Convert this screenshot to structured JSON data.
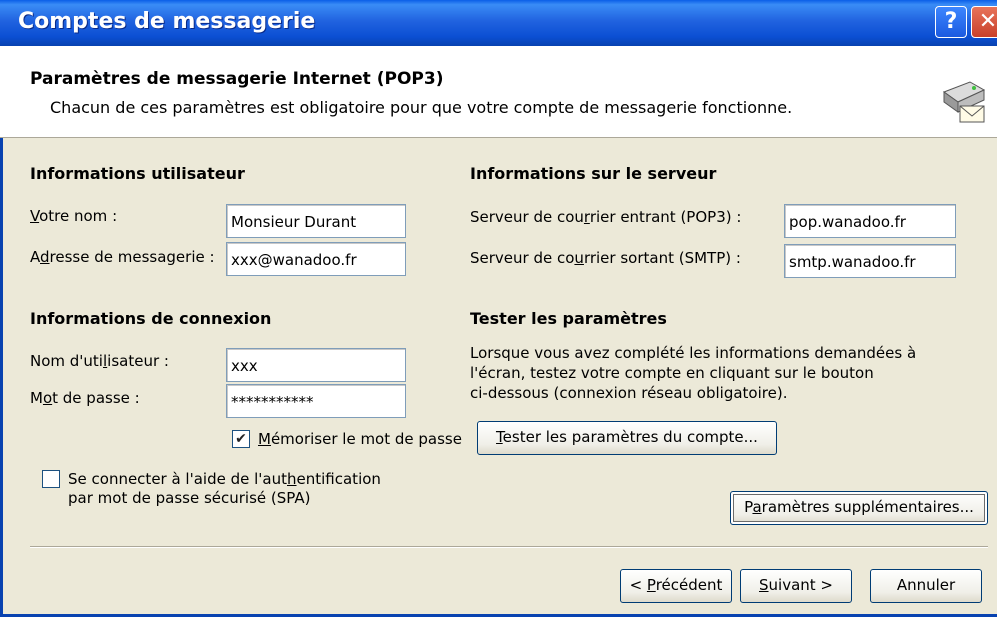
{
  "window": {
    "title": "Comptes de messagerie",
    "help_glyph": "?",
    "close_glyph": "✕"
  },
  "header": {
    "title": "Paramètres de messagerie Internet (POP3)",
    "subtitle": "Chacun de ces paramètres est obligatoire pour que votre compte de messagerie fonctionne.",
    "icon": "mail-server-icon"
  },
  "user_info": {
    "heading": "Informations utilisateur",
    "name_label": "Votre nom :",
    "name_value": "Monsieur Durant",
    "email_label": "Adresse de messagerie :",
    "email_value": "xxx@wanadoo.fr"
  },
  "server_info": {
    "heading": "Informations sur le serveur",
    "incoming_label": "Serveur de courrier entrant (POP3) :",
    "incoming_value": "pop.wanadoo.fr",
    "outgoing_label": "Serveur de courrier sortant (SMTP) :",
    "outgoing_value": "smtp.wanadoo.fr"
  },
  "login_info": {
    "heading": "Informations de connexion",
    "username_label": "Nom d'utilisateur :",
    "username_value": "xxx",
    "password_label": "Mot de passe :",
    "password_value": "***********",
    "remember_label": "Mémoriser le mot de passe",
    "remember_checked": true,
    "spa_label_line1": "Se connecter à l'aide de l'authentification",
    "spa_label_line2": "par mot de passe sécurisé (SPA)",
    "spa_checked": false
  },
  "test": {
    "heading": "Tester les paramètres",
    "description_lines": [
      "Lorsque vous avez complété les informations demandées à",
      "l'écran, testez votre compte en cliquant sur le bouton",
      "ci-dessous (connexion réseau obligatoire)."
    ],
    "test_button": "Tester les paramètres du compte...",
    "more_settings_button": "Paramètres supplémentaires..."
  },
  "footer": {
    "back_button": "< Précédent",
    "next_button": "Suivant >",
    "cancel_button": "Annuler"
  },
  "colors": {
    "titlebar": "#0b4fd3",
    "dialog_bg": "#ece9d8",
    "header_bg": "#ffffff",
    "field_border": "#7f9db9"
  }
}
